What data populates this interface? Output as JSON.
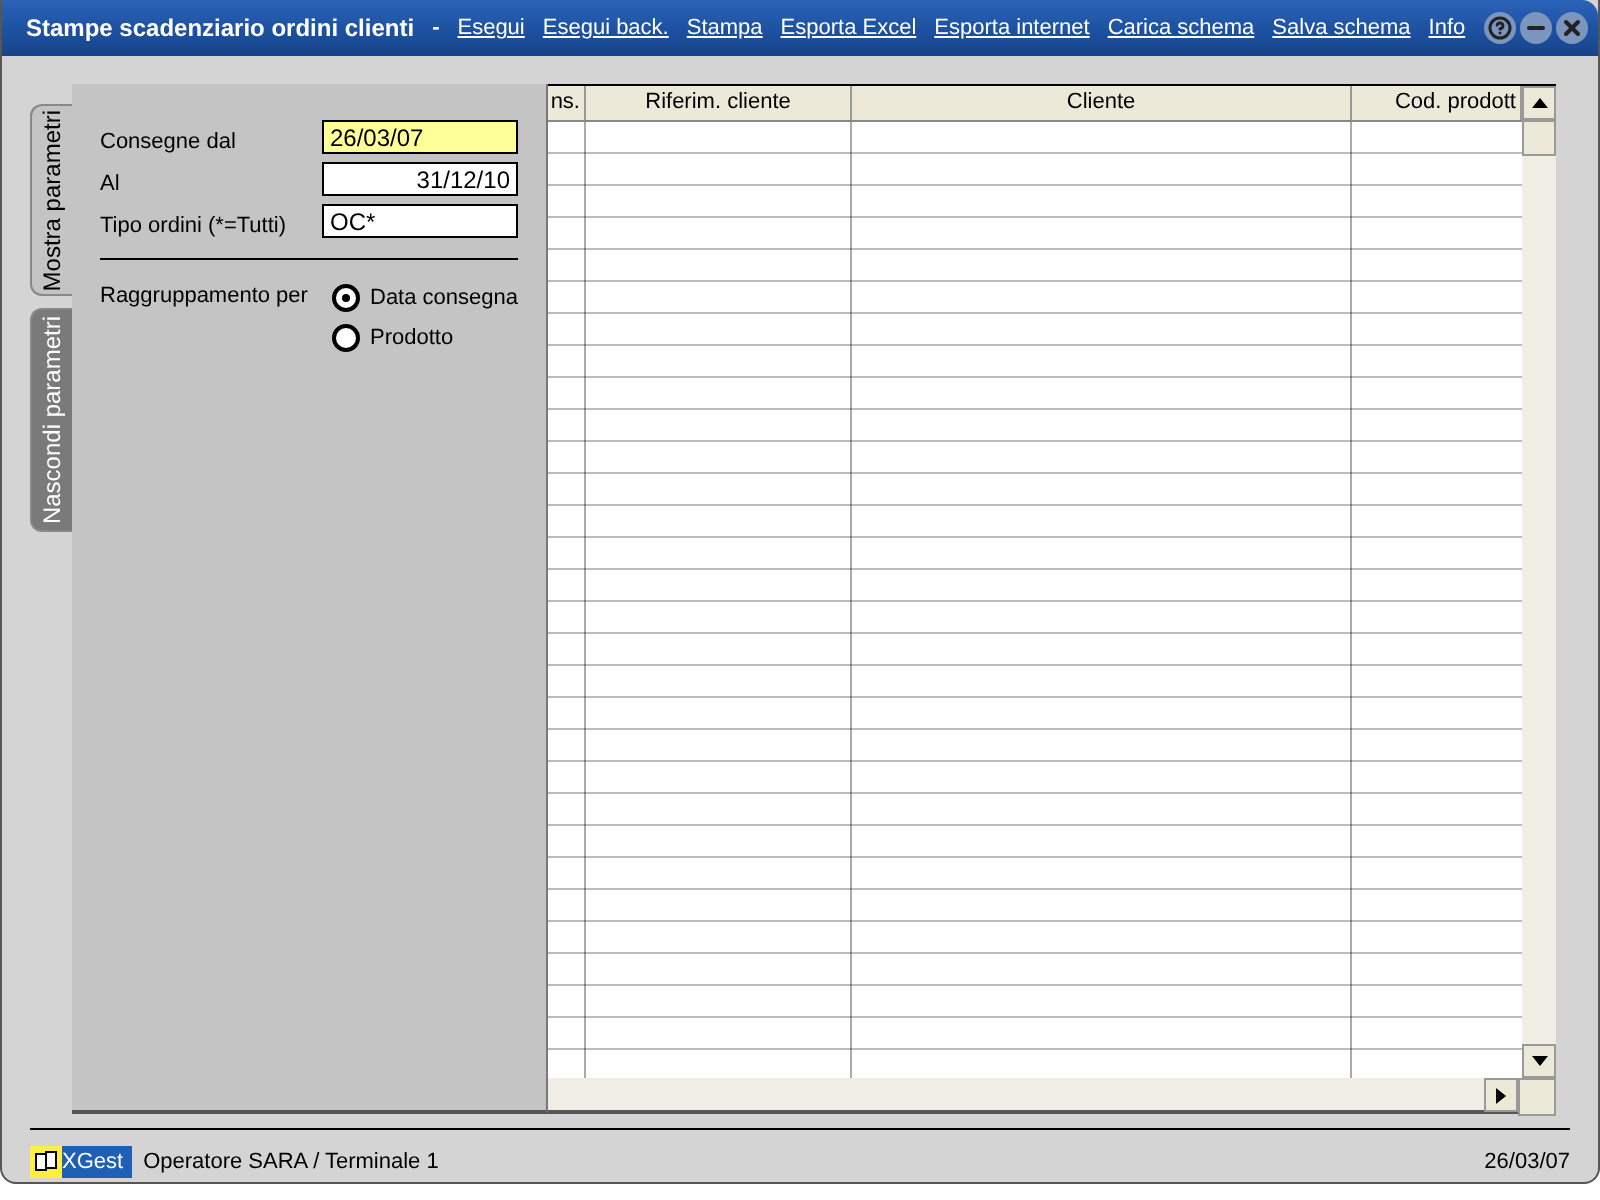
{
  "window": {
    "title": "Stampe scadenziario ordini clienti",
    "separator": "-"
  },
  "menu": [
    "Esegui",
    "Esegui back.",
    "Stampa",
    "Esporta Excel",
    "Esporta internet",
    "Carica schema",
    "Salva schema",
    "Info"
  ],
  "side_tabs": [
    {
      "label": "Mostra parametri",
      "selected": true
    },
    {
      "label": "Nascondi parametri",
      "selected": false
    }
  ],
  "fields": [
    {
      "label": "Consegne dal",
      "value": "26/03/07",
      "focused": true,
      "kind": "date"
    },
    {
      "label": "Al",
      "value": "31/12/10",
      "focused": false,
      "kind": "date"
    },
    {
      "label": "Tipo ordini (*=Tutti)",
      "value": "OC*",
      "focused": false,
      "kind": "text"
    }
  ],
  "grouping": {
    "label": "Raggruppamento per",
    "options": [
      {
        "label": "Data consegna",
        "selected": true
      },
      {
        "label": "Prodotto",
        "selected": false
      }
    ]
  },
  "table": {
    "columns": [
      "ns.",
      "Riferim. cliente",
      "Cliente",
      "Cod. prodott"
    ]
  },
  "status_bar": {
    "app": "XGest",
    "operator": "Operatore SARA / Terminale 1",
    "date": "26/03/07"
  }
}
